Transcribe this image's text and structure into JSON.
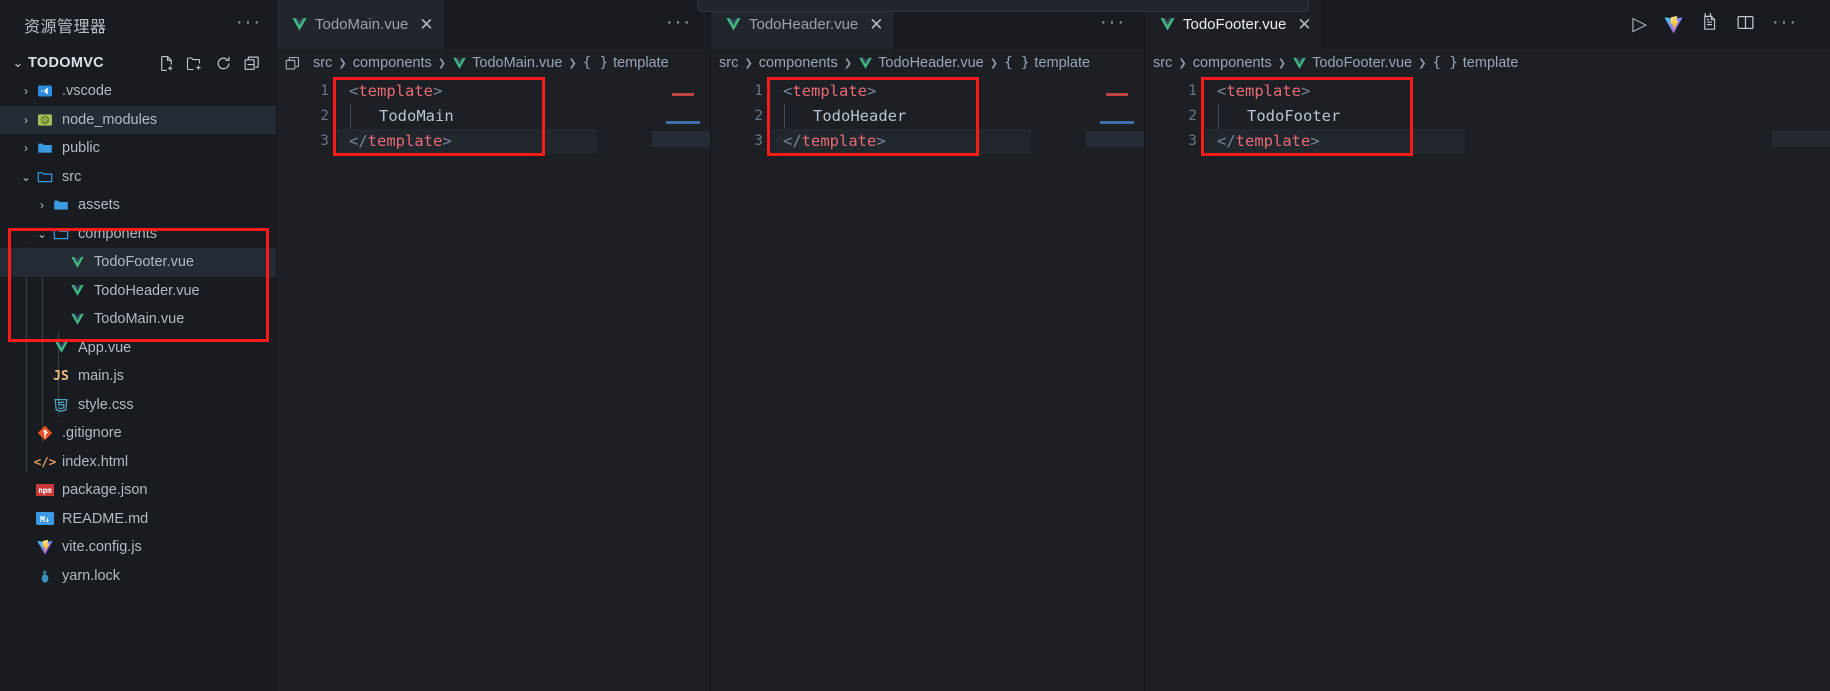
{
  "sidebar": {
    "title": "资源管理器",
    "more_label": "···",
    "root": {
      "label": "TODOMVC",
      "chevron": "⌄",
      "actions": [
        "new-file",
        "new-folder",
        "refresh",
        "collapse-all"
      ]
    },
    "items": [
      {
        "label": ".vscode",
        "type": "folder-vscode",
        "twisty": "›",
        "indent": 1,
        "selected": false
      },
      {
        "label": "node_modules",
        "type": "folder-node",
        "twisty": "›",
        "indent": 1,
        "selected": true
      },
      {
        "label": "public",
        "type": "folder-blue",
        "twisty": "›",
        "indent": 1,
        "selected": false
      },
      {
        "label": "src",
        "type": "folder-open",
        "twisty": "⌄",
        "indent": 1,
        "selected": false
      },
      {
        "label": "assets",
        "type": "folder-blue",
        "twisty": "›",
        "indent": 2,
        "selected": false
      },
      {
        "label": "components",
        "type": "folder-open",
        "twisty": "⌄",
        "indent": 2,
        "selected": false
      },
      {
        "label": "TodoFooter.vue",
        "type": "vue",
        "twisty": "",
        "indent": 3,
        "selected": true
      },
      {
        "label": "TodoHeader.vue",
        "type": "vue",
        "twisty": "",
        "indent": 3,
        "selected": false
      },
      {
        "label": "TodoMain.vue",
        "type": "vue",
        "twisty": "",
        "indent": 3,
        "selected": false
      },
      {
        "label": "App.vue",
        "type": "vue",
        "twisty": "",
        "indent": 2,
        "selected": false
      },
      {
        "label": "main.js",
        "type": "js",
        "twisty": "",
        "indent": 2,
        "selected": false
      },
      {
        "label": "style.css",
        "type": "css",
        "twisty": "",
        "indent": 2,
        "selected": false
      },
      {
        "label": ".gitignore",
        "type": "git",
        "twisty": "",
        "indent": 1,
        "selected": false
      },
      {
        "label": "index.html",
        "type": "html",
        "twisty": "",
        "indent": 1,
        "selected": false
      },
      {
        "label": "package.json",
        "type": "npm",
        "twisty": "",
        "indent": 1,
        "selected": false
      },
      {
        "label": "README.md",
        "type": "md",
        "twisty": "",
        "indent": 1,
        "selected": false
      },
      {
        "label": "vite.config.js",
        "type": "vite",
        "twisty": "",
        "indent": 1,
        "selected": false
      },
      {
        "label": "yarn.lock",
        "type": "yarn",
        "twisty": "",
        "indent": 1,
        "selected": false
      }
    ]
  },
  "groups": [
    {
      "tab": {
        "label": "TodoMain.vue",
        "icon": "vue-icon",
        "close": "✕",
        "active": false
      },
      "overflow": "···",
      "breadcrumbs": [
        {
          "text": "src",
          "icon": ""
        },
        {
          "text": "components",
          "icon": ""
        },
        {
          "text": "TodoMain.vue",
          "icon": "vue-icon"
        },
        {
          "text": "template",
          "icon": "braces-icon"
        }
      ],
      "code": [
        {
          "num": "1",
          "punct_open": "<",
          "tag": "template",
          "punct_close": ">",
          "kind": "tag-open"
        },
        {
          "num": "2",
          "text": "TodoMain",
          "kind": "text"
        },
        {
          "num": "3",
          "punct_open": "</",
          "tag": "template",
          "punct_close": ">",
          "kind": "tag-close"
        }
      ]
    },
    {
      "tab": {
        "label": "TodoHeader.vue",
        "icon": "vue-icon",
        "close": "✕",
        "active": false
      },
      "overflow": "···",
      "breadcrumbs": [
        {
          "text": "src",
          "icon": ""
        },
        {
          "text": "components",
          "icon": ""
        },
        {
          "text": "TodoHeader.vue",
          "icon": "vue-icon"
        },
        {
          "text": "template",
          "icon": "braces-icon"
        }
      ],
      "code": [
        {
          "num": "1",
          "punct_open": "<",
          "tag": "template",
          "punct_close": ">",
          "kind": "tag-open"
        },
        {
          "num": "2",
          "text": "TodoHeader",
          "kind": "text"
        },
        {
          "num": "3",
          "punct_open": "</",
          "tag": "template",
          "punct_close": ">",
          "kind": "tag-close"
        }
      ]
    },
    {
      "tab": {
        "label": "TodoFooter.vue",
        "icon": "vue-icon",
        "close": "✕",
        "active": true
      },
      "overflow": "",
      "breadcrumbs": [
        {
          "text": "src",
          "icon": ""
        },
        {
          "text": "components",
          "icon": ""
        },
        {
          "text": "TodoFooter.vue",
          "icon": "vue-icon"
        },
        {
          "text": "template",
          "icon": "braces-icon"
        }
      ],
      "code": [
        {
          "num": "1",
          "punct_open": "<",
          "tag": "template",
          "punct_close": ">",
          "kind": "tag-open"
        },
        {
          "num": "2",
          "text": "TodoFooter",
          "kind": "text"
        },
        {
          "num": "3",
          "punct_open": "</",
          "tag": "template",
          "punct_close": ">",
          "kind": "tag-close"
        }
      ],
      "actions": [
        {
          "name": "run-button",
          "glyph": "▷"
        },
        {
          "name": "vite-logo-icon",
          "glyph": ""
        },
        {
          "name": "open-preview-icon",
          "glyph": ""
        },
        {
          "name": "split-editor-icon",
          "glyph": ""
        },
        {
          "name": "more-actions-icon",
          "glyph": "···"
        }
      ]
    }
  ],
  "colors": {
    "accent_red": "#fb1b1b",
    "vue_green": "#41b883",
    "tag_red": "#e86b75",
    "bg_editor": "#1c2025",
    "bg_sidebar": "#181c20"
  }
}
